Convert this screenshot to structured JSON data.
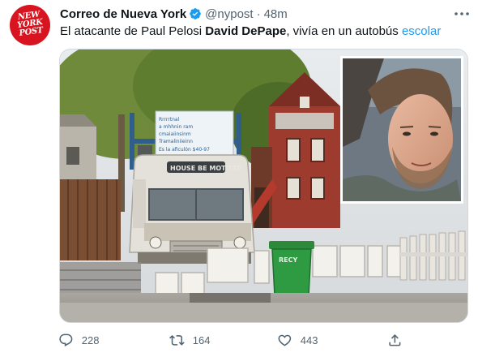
{
  "author": {
    "display_name": "Correo de Nueva York",
    "handle": "@nypost",
    "separator": "·",
    "time": "48m",
    "verified": true,
    "avatar_lines": [
      "NEW",
      "YORK",
      "POST"
    ]
  },
  "tweet": {
    "text_before": "El atacante de Paul Pelosi ",
    "text_comma_gap": ", ",
    "text_bold": "David DePape",
    "text_after": ", vivía en un autobús ",
    "hashtag": "escolar"
  },
  "media": {
    "bus_sign": "HOUSE BE MOTITTE",
    "banner_text": [
      "Rrrrrtnal",
      "a mhhnin ram",
      "cmaiaiinsinm",
      "Tramaliniieinn",
      "Es la aficulón  $40-97"
    ],
    "bin_text": "RECY"
  },
  "actions": {
    "reply_count": "228",
    "retweet_count": "164",
    "like_count": "443"
  },
  "colors": {
    "accent": "#1d9bf0",
    "secondary_text": "#536471",
    "avatar_red": "#d7141f",
    "border": "#cfd9de"
  },
  "icons": [
    "verified-badge-icon",
    "more-options-icon",
    "reply-icon",
    "retweet-icon",
    "like-icon",
    "share-icon"
  ]
}
